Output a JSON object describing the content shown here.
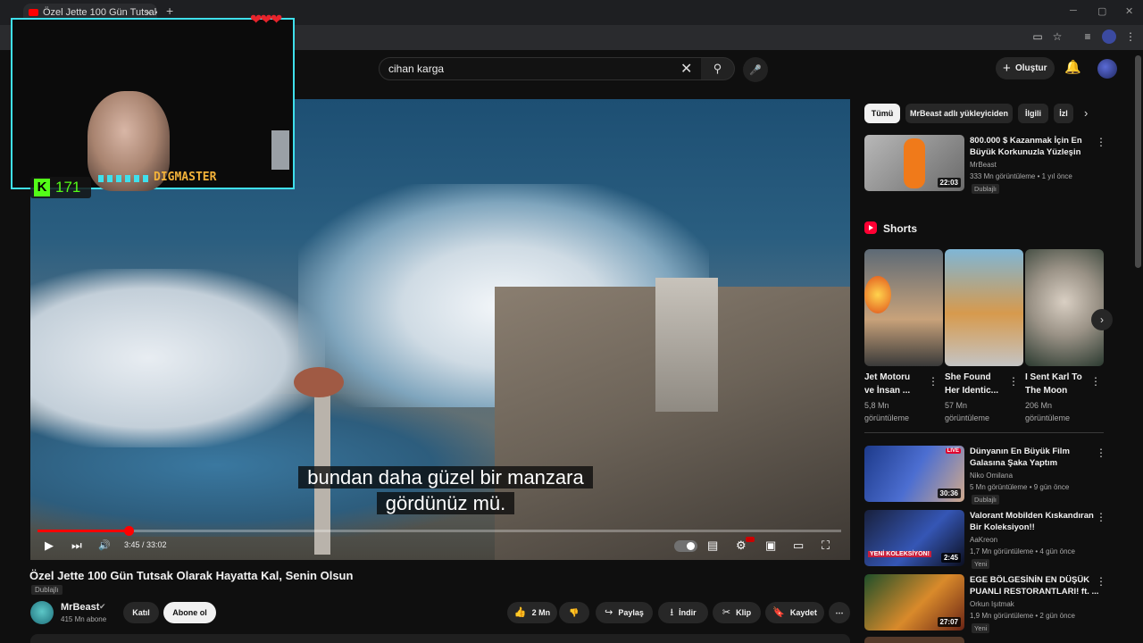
{
  "browser": {
    "tab_title": "Özel Jette 100 Gün Tutsak Olu",
    "tab_close": "×",
    "new_tab": "+",
    "min": "─",
    "restore": "▢",
    "close": "✕"
  },
  "header": {
    "search_value": "cihan karga",
    "search_clear": "✕",
    "search_icon": "⚲",
    "mic_icon": "🎤",
    "create_label": "Oluştur",
    "create_plus": "+",
    "bell_icon": "🔔"
  },
  "player": {
    "subtitle_line1": "bundan daha güzel bir manzara",
    "subtitle_line2": "gördünüz mü.",
    "time": "3:45 / 33:02",
    "progress": 0.113,
    "play_icon": "▶",
    "next_icon": "⏭",
    "volume_icon": "🔊",
    "captions_icon": "▤",
    "settings_icon": "⚙",
    "miniplayer_icon": "▣",
    "theater_icon": "▭",
    "fullscreen_icon": "⛶"
  },
  "overlay": {
    "hearts": "❤❤❤",
    "kick_logo": "K",
    "kick_count": "171",
    "streamer_name": "DIGMASTER"
  },
  "video": {
    "title": "Özel Jette 100 Gün Tutsak Olarak Hayatta Kal, Senin Olsun",
    "dubbed": "Dublajlı",
    "channel": "MrBeast",
    "verified": "✔",
    "subscribers": "415 Mn abone",
    "join": "Katıl",
    "subscribe": "Abone ol",
    "likes": "2 Mn",
    "like_icon": "👍",
    "dislike_icon": "👎",
    "share": "Paylaş",
    "share_icon": "↪",
    "download": "İndir",
    "download_icon": "⭳",
    "clip": "Klip",
    "clip_icon": "✂",
    "save": "Kaydet",
    "save_icon": "🔖",
    "more": "⋯"
  },
  "chips": [
    "Tümü",
    "MrBeast adlı yükleyiciden",
    "İlgili",
    "İzl"
  ],
  "chip_next": "›",
  "recommended_top": {
    "title_line1": "800.000 $ Kazanmak İçin En",
    "title_line2": "Büyük Korkunuzla Yüzleşin",
    "channel": "MrBeast",
    "meta": "333 Mn görüntüleme • 1 yıl önce",
    "dubbed": "Dublajlı",
    "duration": "22:03"
  },
  "shorts": {
    "title": "Shorts",
    "next": "›",
    "items": [
      {
        "line1": "Jet Motoru",
        "line2": "ve İnsan ...",
        "views1": "5,8 Mn",
        "views2": "görüntüleme"
      },
      {
        "line1": "She Found",
        "line2": "Her Identic...",
        "views1": "57 Mn",
        "views2": "görüntüleme"
      },
      {
        "line1": "I Sent Karl To",
        "line2": "The Moon",
        "views1": "206 Mn",
        "views2": "görüntüleme"
      }
    ]
  },
  "recommended": [
    {
      "title_line1": "Dünyanın En Büyük Film",
      "title_line2": "Galasına Şaka Yaptım",
      "channel": "Niko Omilana",
      "meta": "5 Mn görüntüleme • 9 gün önce",
      "badge": "Dublajlı",
      "duration": "30:36",
      "live_tag": "LIVE"
    },
    {
      "title_line1": "Valorant Mobilden Kıskandıran",
      "title_line2": "Bir Koleksiyon!!",
      "channel": "AaKreon",
      "meta": "1,7 Mn görüntüleme • 4 gün önce",
      "badge": "Yeni",
      "duration": "2:45",
      "thumb_text": "YENİ KOLEKSİYON!"
    },
    {
      "title_line1": "EGE BÖLGESİNİN EN DÜŞÜK",
      "title_line2": "PUANLI RESTORANTLARI! ft. ...",
      "channel": "Orkun Işıtmak",
      "meta": "1,9 Mn görüntüleme • 2 gün önce",
      "badge": "Yeni",
      "duration": "27:07"
    }
  ],
  "kebab": "⋮"
}
